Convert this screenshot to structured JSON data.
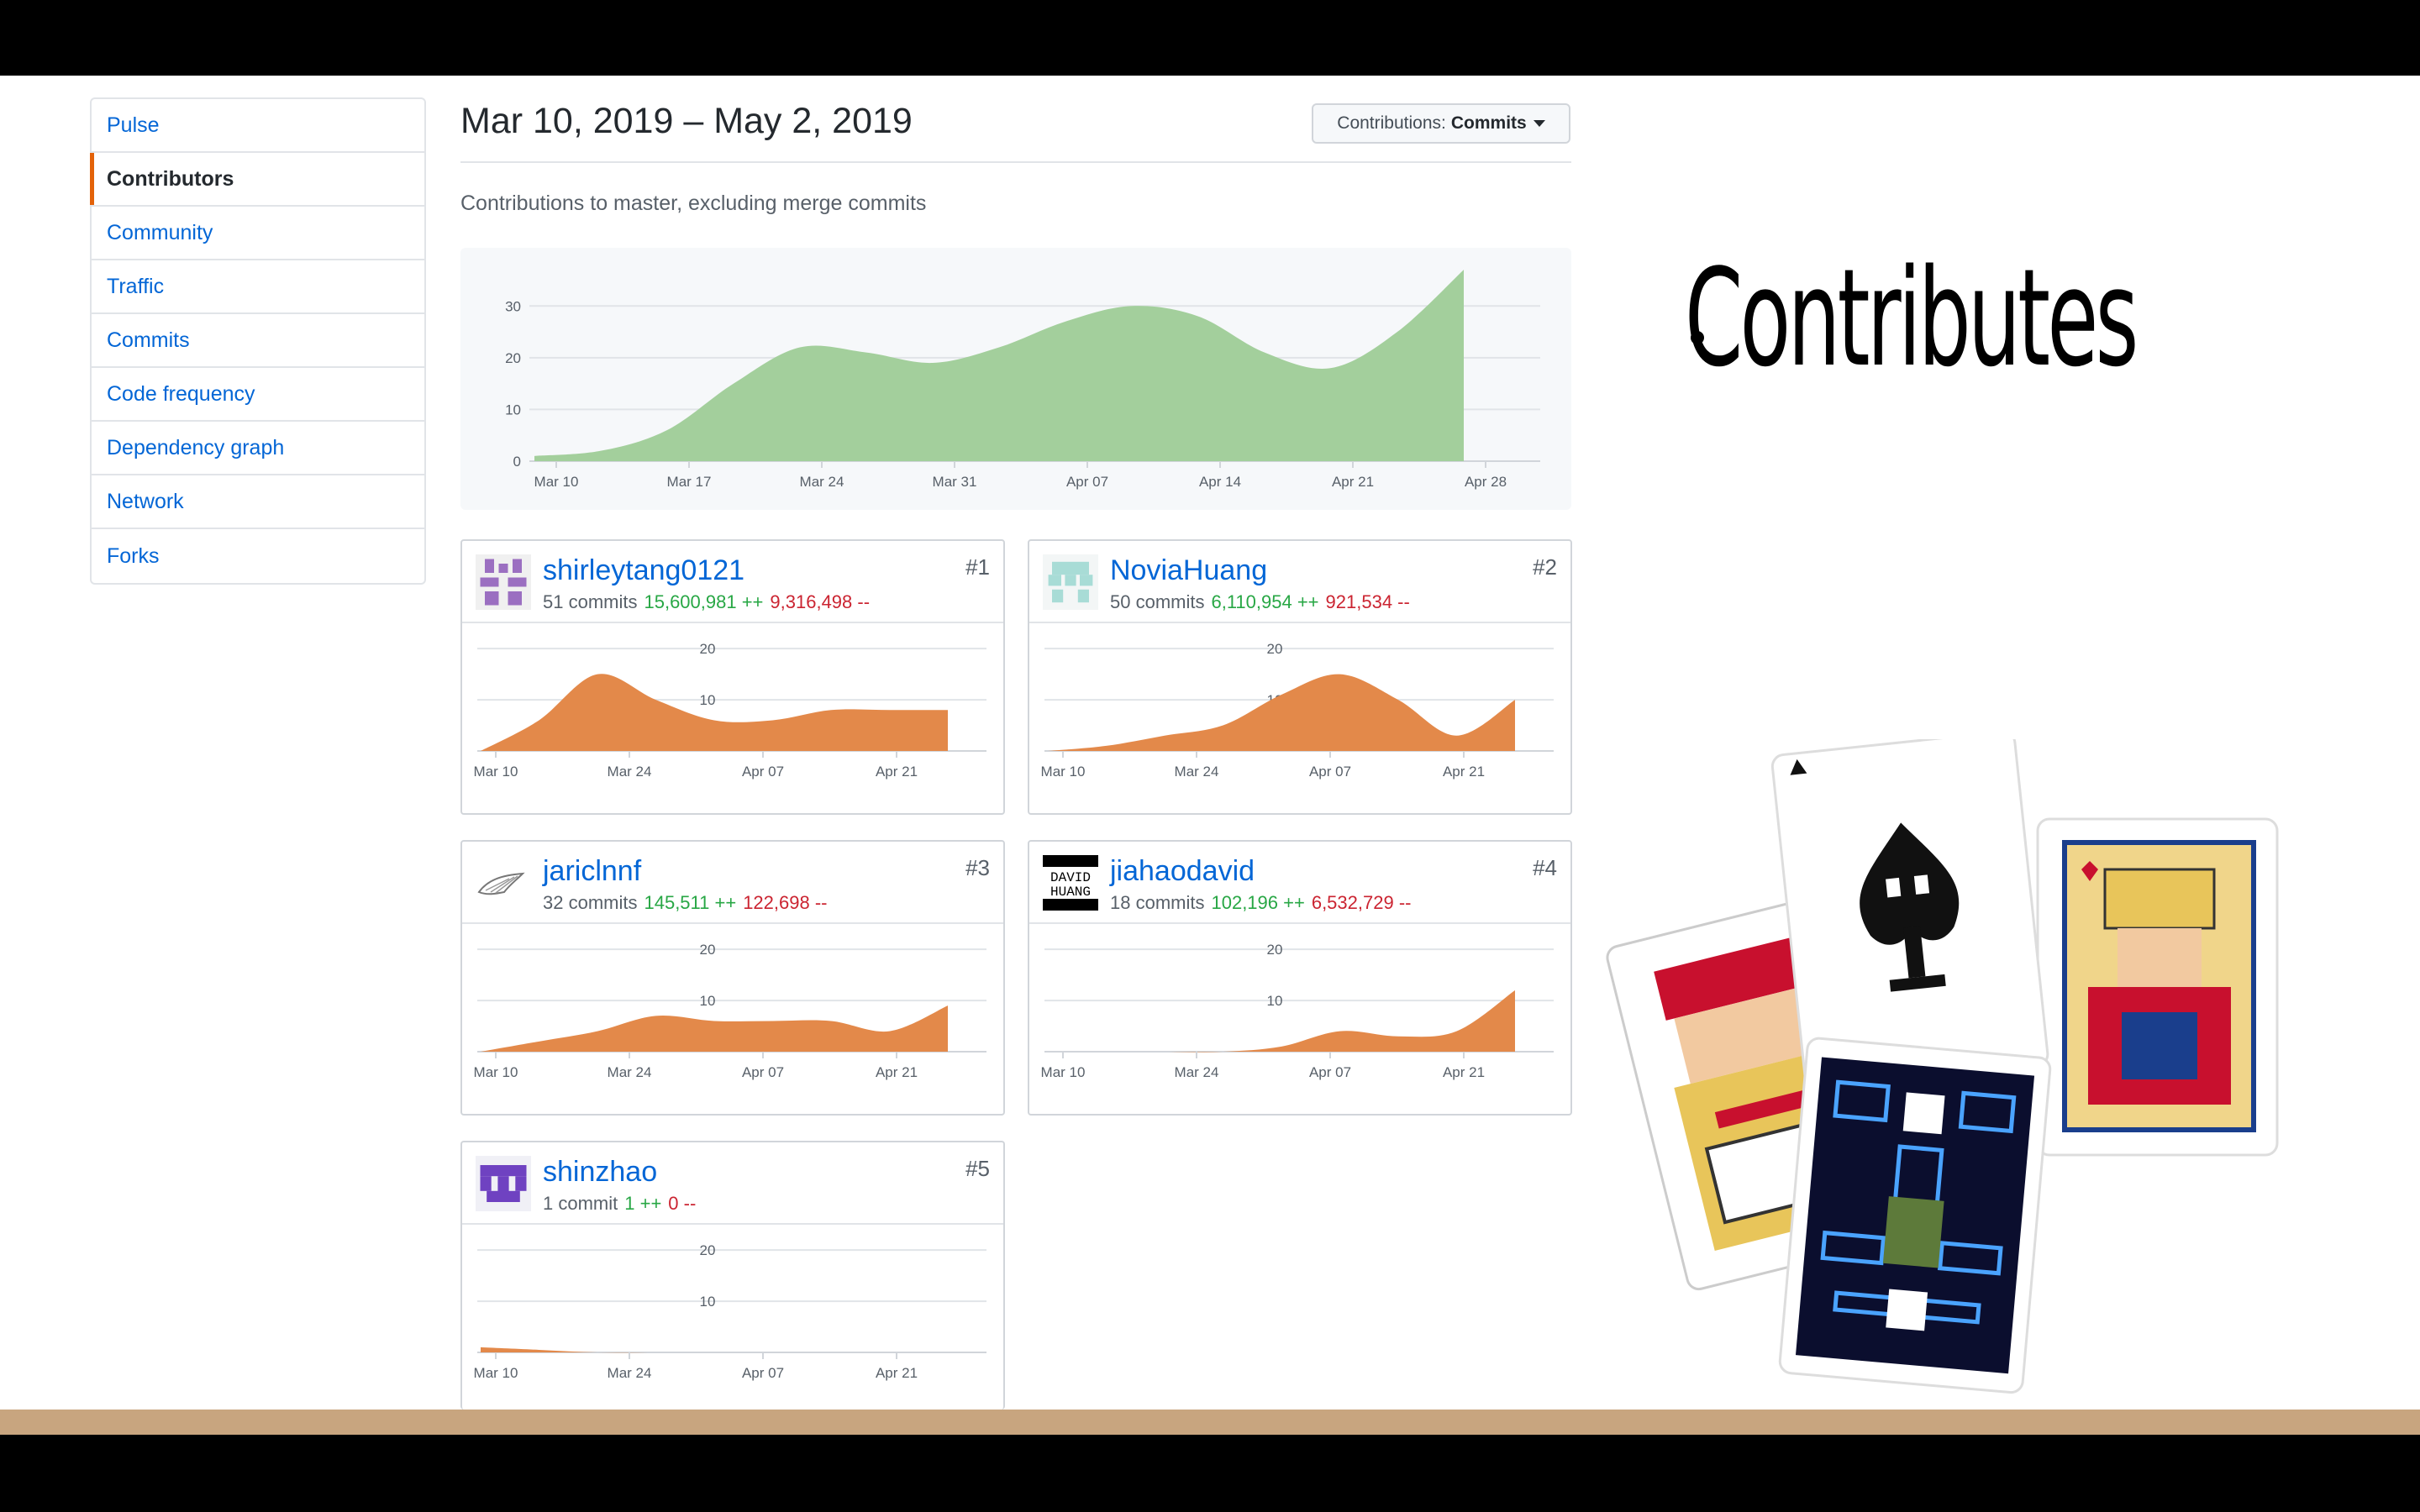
{
  "sidebar": {
    "items": [
      {
        "label": "Pulse"
      },
      {
        "label": "Contributors"
      },
      {
        "label": "Community"
      },
      {
        "label": "Traffic"
      },
      {
        "label": "Commits"
      },
      {
        "label": "Code frequency"
      },
      {
        "label": "Dependency graph"
      },
      {
        "label": "Network"
      },
      {
        "label": "Forks"
      }
    ],
    "active": "Contributors"
  },
  "header": {
    "range": "Mar 10, 2019 – May 2, 2019",
    "select_prefix": "Contributions:",
    "select_value": "Commits",
    "subtitle": "Contributions to master, excluding merge commits"
  },
  "contributors": [
    {
      "name": "shirleytang0121",
      "commits": "51 commits",
      "additions": "15,600,981 ++",
      "deletions": "9,316,498 --",
      "rank": "#1",
      "avatar_icon": "purple-identicon"
    },
    {
      "name": "NoviaHuang",
      "commits": "50 commits",
      "additions": "6,110,954 ++",
      "deletions": "921,534 --",
      "rank": "#2",
      "avatar_icon": "teal-identicon"
    },
    {
      "name": "jariclnnf",
      "commits": "32 commits",
      "additions": "145,511 ++",
      "deletions": "122,698 --",
      "rank": "#3",
      "avatar_icon": "sketch-avatar"
    },
    {
      "name": "jiahaodavid",
      "commits": "18 commits",
      "additions": "102,196 ++",
      "deletions": "6,532,729 --",
      "rank": "#4",
      "avatar_icon": "david-huang-avatar",
      "avatar_text": [
        "DAVID",
        "HUANG"
      ]
    },
    {
      "name": "shinzhao",
      "commits": "1 commit",
      "additions": "1 ++",
      "deletions": "0 --",
      "rank": "#5",
      "avatar_icon": "violet-identicon"
    }
  ],
  "slide": {
    "bullet": "Contributes"
  },
  "colors": {
    "link": "#0366d6",
    "main_area": "#a3cf9c",
    "contributor_area": "#e3894a",
    "active_marker": "#e36209",
    "additions": "#28a745",
    "deletions": "#cb2431",
    "footer_band": "#c8a57f"
  },
  "chart_data": [
    {
      "type": "area",
      "x": [
        "Mar 10",
        "Mar 13",
        "Mar 17",
        "Mar 20",
        "Mar 24",
        "Mar 27",
        "Mar 31",
        "Apr 03",
        "Apr 07",
        "Apr 10",
        "Apr 14",
        "Apr 17",
        "Apr 21",
        "Apr 24",
        "Apr 27"
      ],
      "values": [
        1,
        2,
        6,
        15,
        22,
        21,
        19,
        22,
        27,
        30,
        28,
        21,
        18,
        25,
        37
      ],
      "x_ticks": [
        "Mar 10",
        "Mar 17",
        "Mar 24",
        "Mar 31",
        "Apr 07",
        "Apr 14",
        "Apr 21",
        "Apr 28"
      ],
      "y_ticks": [
        "0",
        "10",
        "20",
        "30"
      ],
      "ylim": [
        0,
        38
      ],
      "grid": true
    },
    {
      "type": "area",
      "series": [
        {
          "name": "shirleytang0121",
          "values": [
            0,
            6,
            15,
            10,
            6,
            6,
            8,
            8,
            8
          ]
        }
      ],
      "x_ticks": [
        "Mar 10",
        "Mar 24",
        "Apr 07",
        "Apr 21"
      ],
      "y_ticks": [
        "10",
        "20"
      ],
      "ylim": [
        0,
        22
      ]
    },
    {
      "type": "area",
      "series": [
        {
          "name": "NoviaHuang",
          "values": [
            0,
            1,
            3,
            5,
            11,
            15,
            10,
            3,
            10
          ]
        }
      ],
      "x_ticks": [
        "Mar 10",
        "Mar 24",
        "Apr 07",
        "Apr 21"
      ],
      "y_ticks": [
        "10",
        "20"
      ],
      "ylim": [
        0,
        22
      ]
    },
    {
      "type": "area",
      "series": [
        {
          "name": "jariclnnf",
          "values": [
            0,
            2,
            4,
            7,
            6,
            6,
            6,
            4,
            9
          ]
        }
      ],
      "x_ticks": [
        "Mar 10",
        "Mar 24",
        "Apr 07",
        "Apr 21"
      ],
      "y_ticks": [
        "10",
        "20"
      ],
      "ylim": [
        0,
        22
      ]
    },
    {
      "type": "area",
      "series": [
        {
          "name": "jiahaodavid",
          "values": [
            0,
            0,
            0,
            0,
            1,
            4,
            3,
            4,
            12
          ]
        }
      ],
      "x_ticks": [
        "Mar 10",
        "Mar 24",
        "Apr 07",
        "Apr 21"
      ],
      "y_ticks": [
        "10",
        "20"
      ],
      "ylim": [
        0,
        22
      ]
    },
    {
      "type": "area",
      "series": [
        {
          "name": "shinzhao",
          "values": [
            1,
            0.5,
            0,
            0,
            0,
            0,
            0,
            0,
            0
          ]
        }
      ],
      "x_ticks": [
        "Mar 10",
        "Mar 24",
        "Apr 07",
        "Apr 21"
      ],
      "y_ticks": [
        "10",
        "20"
      ],
      "ylim": [
        0,
        22
      ]
    }
  ]
}
